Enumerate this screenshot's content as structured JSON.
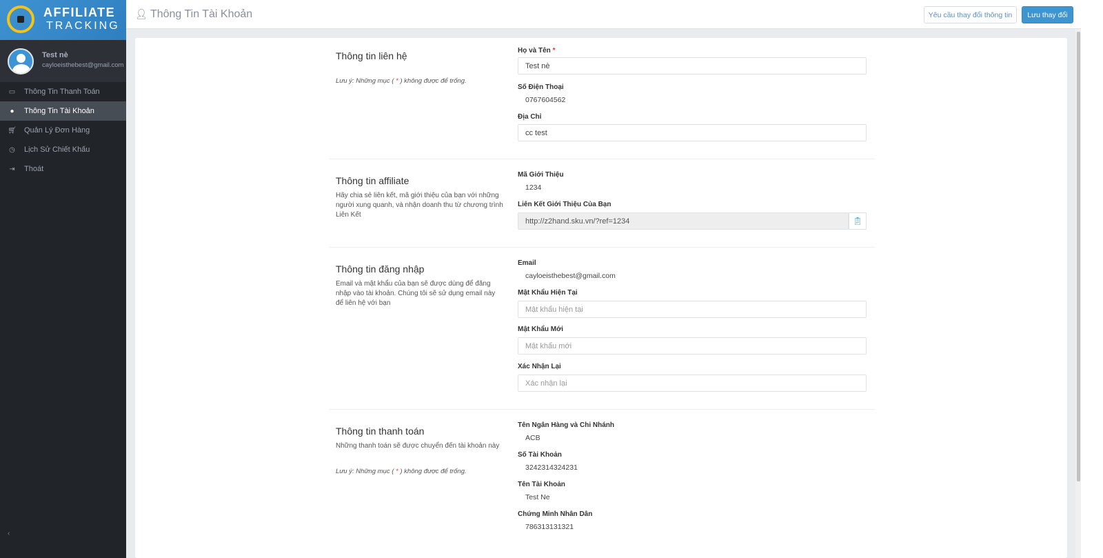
{
  "logo": {
    "line1": "AFFILIATE",
    "line2": "TRACKING"
  },
  "user": {
    "name": "Test nè",
    "email": "cayloeisthebest@gmail.com"
  },
  "menu": [
    {
      "label": "Thông Tin Thanh Toán",
      "icon": "money-icon"
    },
    {
      "label": "Thông Tin Tài Khoản",
      "icon": "user-icon"
    },
    {
      "label": "Quản Lý Đơn Hàng",
      "icon": "cart-icon"
    },
    {
      "label": "Lịch Sử Chiết Khấu",
      "icon": "clock-icon"
    },
    {
      "label": "Thoát",
      "icon": "logout-icon"
    }
  ],
  "header": {
    "title": "Thông Tin Tài Khoản",
    "request_label": "Yêu cầu thay đổi thông tin",
    "save_label": "Lưu thay đổi"
  },
  "contact": {
    "title": "Thông tin liên hệ",
    "note_pre": "Lưu ý: Những mục (",
    "note_star": " * ",
    "note_post": ") không được để trống.",
    "name_label": "Họ và Tên",
    "name_value": "Test nè",
    "phone_label": "Số Điện Thoại",
    "phone_value": "0767604562",
    "address_label": "Địa Chỉ",
    "address_value": "cc test"
  },
  "affiliate": {
    "title": "Thông tin affiliate",
    "desc": "Hãy chia sẻ liên kết, mã giới thiệu của bạn với những người xung quanh, và nhận doanh thu từ chương trình Liên Kết",
    "code_label": "Mã Giới Thiệu",
    "code_value": "1234",
    "link_label": "Liên Kết Giới Thiệu Của Bạn",
    "link_value": "http://z2hand.sku.vn/?ref=1234"
  },
  "login": {
    "title": "Thông tin đăng nhập",
    "desc": "Email và mật khẩu của bạn sẽ được dùng để đăng nhập vào tài khoản. Chúng tôi sẽ sử dụng email này để liên hệ với bạn",
    "email_label": "Email",
    "email_value": "cayloeisthebest@gmail.com",
    "current_label": "Mật Khẩu Hiện Tại",
    "current_placeholder": "Mật khẩu hiện tại",
    "new_label": "Mật Khẩu Mới",
    "new_placeholder": "Mật khẩu mới",
    "confirm_label": "Xác Nhận Lại",
    "confirm_placeholder": "Xác nhận lại"
  },
  "payment": {
    "title": "Thông tin thanh toán",
    "desc": "Những thanh toán sẽ được chuyển đến tài khoản này",
    "bank_label": "Tên Ngân Hàng và Chi Nhánh",
    "bank_value": "ACB",
    "account_no_label": "Số Tài Khoản",
    "account_no_value": "3242314324231",
    "account_name_label": "Tên Tài Khoản",
    "account_name_value": "Test Ne",
    "id_label": "Chứng Minh Nhân Dân",
    "id_value": "786313131321"
  }
}
